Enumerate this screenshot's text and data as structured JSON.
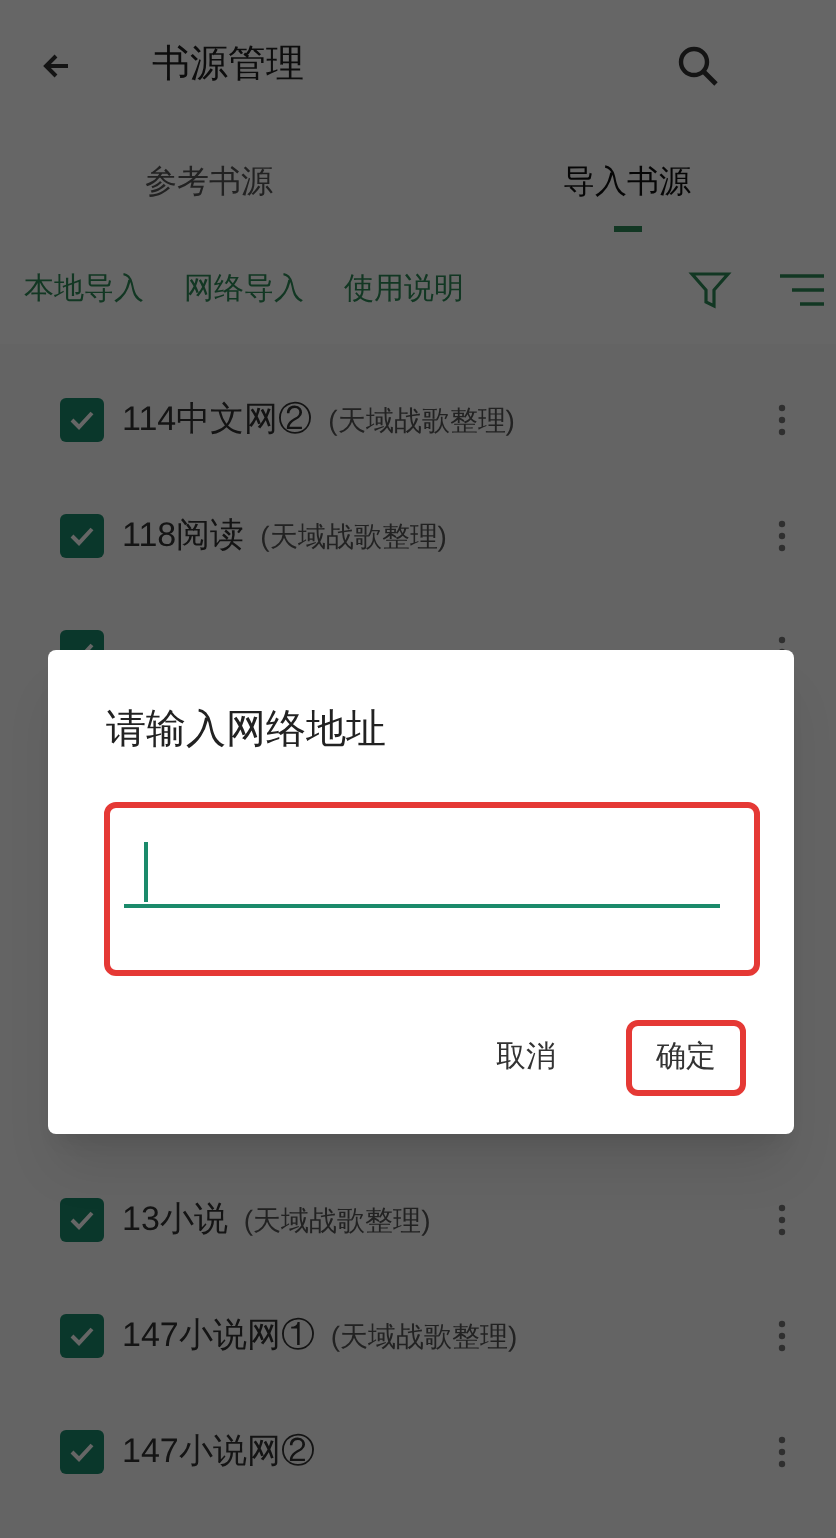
{
  "app_bar": {
    "title": "书源管理"
  },
  "tabs": [
    {
      "label": "参考书源",
      "selected": false
    },
    {
      "label": "导入书源",
      "selected": true
    }
  ],
  "actions": [
    "本地导入",
    "网络导入",
    "使用说明"
  ],
  "sources_top": [
    {
      "name": "114中文网②",
      "note": "(天域战歌整理)",
      "checked": true
    },
    {
      "name": "118阅读",
      "note": "(天域战歌整理)",
      "checked": true
    },
    {
      "checked": true
    }
  ],
  "sources_bottom": [
    {
      "name": "13小说",
      "note": "(天域战歌整理)",
      "checked": true
    },
    {
      "name": "147小说网①",
      "note": "(天域战歌整理)",
      "checked": true
    },
    {
      "name": "147小说网②",
      "checked": true
    }
  ],
  "dialog": {
    "title": "请输入网络地址",
    "input": {
      "highlighted": true
    },
    "buttons": [
      {
        "label": "取消",
        "highlighted": false
      },
      {
        "label": "确定",
        "highlighted": true
      }
    ]
  }
}
